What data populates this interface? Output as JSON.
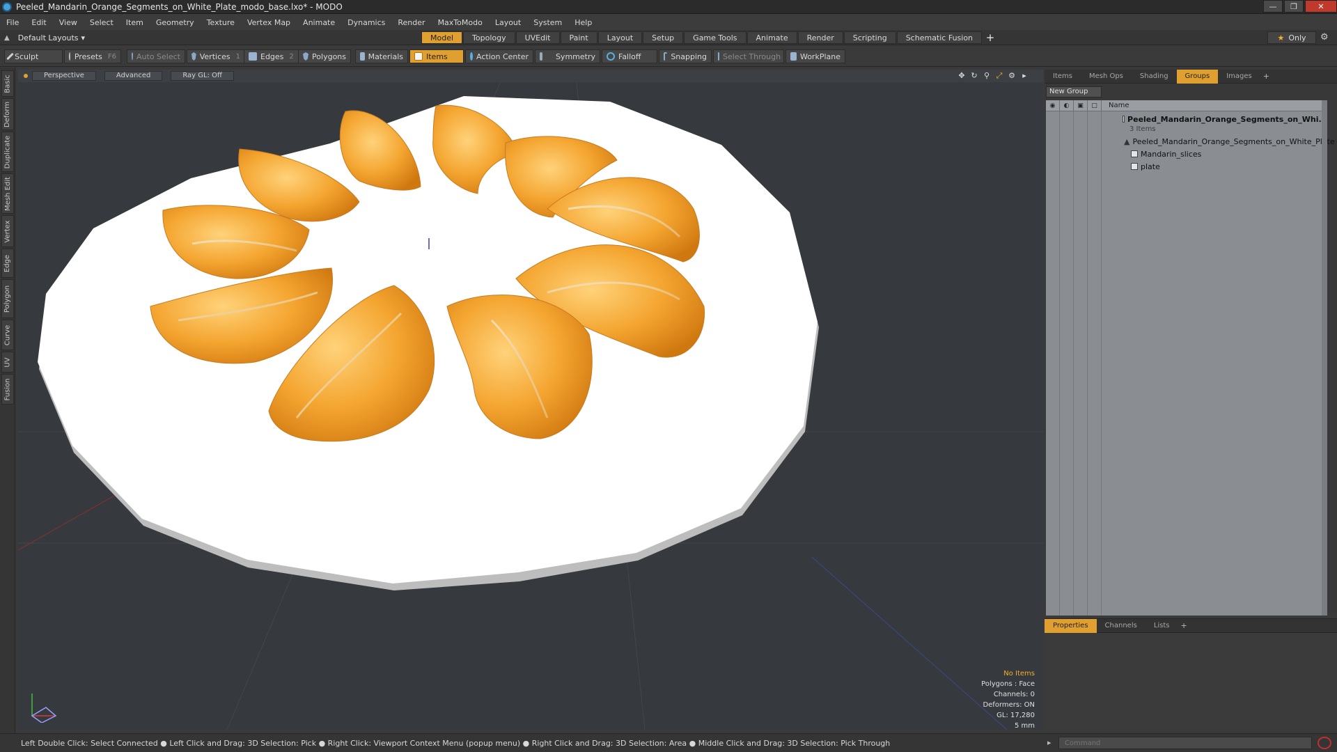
{
  "window": {
    "title": "Peeled_Mandarin_Orange_Segments_on_White_Plate_modo_base.lxo* - MODO"
  },
  "menu": [
    "File",
    "Edit",
    "View",
    "Select",
    "Item",
    "Geometry",
    "Texture",
    "Vertex Map",
    "Animate",
    "Dynamics",
    "Render",
    "MaxToModo",
    "Layout",
    "System",
    "Help"
  ],
  "layout": {
    "dropdown": "Default Layouts",
    "tabs": [
      "Model",
      "Topology",
      "UVEdit",
      "Paint",
      "Layout",
      "Setup",
      "Game Tools",
      "Animate",
      "Render",
      "Scripting",
      "Schematic Fusion"
    ],
    "active_tab": "Model",
    "only_label": "Only"
  },
  "toolbar": {
    "sculpt": "Sculpt",
    "presets": "Presets",
    "presets_key": "F6",
    "auto_select": "Auto Select",
    "vertices": "Vertices",
    "vertices_key": "1",
    "edges": "Edges",
    "edges_key": "2",
    "polygons": "Polygons",
    "materials": "Materials",
    "items": "Items",
    "action_center": "Action Center",
    "symmetry": "Symmetry",
    "falloff": "Falloff",
    "snapping": "Snapping",
    "select_through": "Select Through",
    "workplane": "WorkPlane"
  },
  "left_tabs": [
    "Basic",
    "Deform",
    "Duplicate",
    "Mesh Edit",
    "Vertex",
    "Edge",
    "Polygon",
    "Curve",
    "UV",
    "Fusion"
  ],
  "viewport": {
    "view": "Perspective",
    "shading": "Advanced",
    "raygl": "Ray GL: Off",
    "info": {
      "selection": "No Items",
      "polygons": "Polygons : Face",
      "channels": "Channels: 0",
      "deformers": "Deformers: ON",
      "gl": "GL: 17,280",
      "unit": "5 mm"
    }
  },
  "right_panel": {
    "tabs": [
      "Items",
      "Mesh Ops",
      "Shading",
      "Groups",
      "Images"
    ],
    "active_tab": "Groups",
    "new_group": "New Group",
    "column_name": "Name",
    "tree": {
      "group": "Peeled_Mandarin_Orange_Segments_on_Whi...",
      "count": "3 Items",
      "children": [
        "Peeled_Mandarin_Orange_Segments_on_White_Plate",
        "Mandarin_slices",
        "plate"
      ]
    }
  },
  "properties_panel": {
    "tabs": [
      "Properties",
      "Channels",
      "Lists"
    ],
    "active_tab": "Properties"
  },
  "status": {
    "hint": "Left Double Click: Select Connected ● Left Click and Drag: 3D Selection: Pick ● Right Click: Viewport Context Menu (popup menu) ● Right Click and Drag: 3D Selection: Area ● Middle Click and Drag: 3D Selection: Pick Through",
    "command_placeholder": "Command"
  },
  "colors": {
    "accent": "#e0a030",
    "viewport_bg": "#36393d",
    "plate": "#ffffff",
    "orange": "#f3a12c"
  }
}
